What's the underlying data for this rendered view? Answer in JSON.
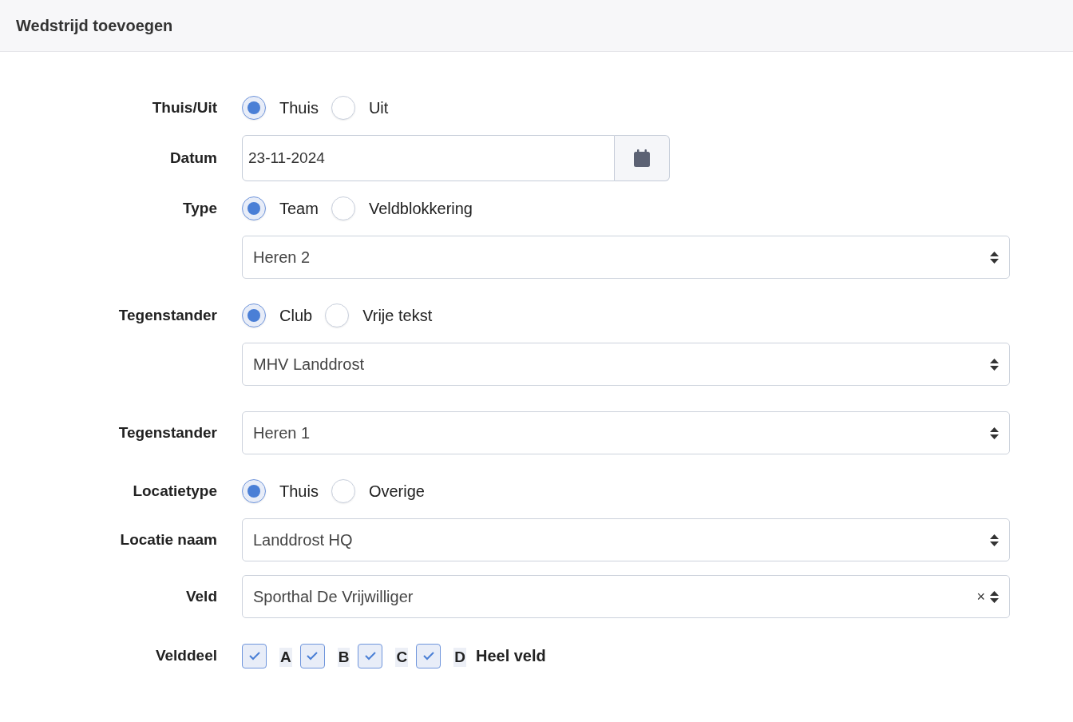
{
  "header": {
    "title": "Wedstrijd toevoegen"
  },
  "rows": [
    {
      "kind": "radio",
      "label": "Thuis/Uit",
      "options": [
        {
          "label": "Thuis",
          "selected": true
        },
        {
          "label": "Uit",
          "selected": false
        }
      ]
    },
    {
      "kind": "date",
      "label": "Datum",
      "value": "23-11-2024"
    },
    {
      "kind": "radio",
      "label": "Type",
      "options": [
        {
          "label": "Team",
          "selected": true
        },
        {
          "label": "Veldblokkering",
          "selected": false
        }
      ]
    },
    {
      "kind": "select",
      "value": "Heren 2"
    },
    {
      "kind": "radio",
      "label": "Tegenstander",
      "options": [
        {
          "label": "Club",
          "selected": true
        },
        {
          "label": "Vrije tekst",
          "selected": false
        }
      ]
    },
    {
      "kind": "select",
      "value": "MHV Landdrost"
    },
    {
      "kind": "select",
      "label": "Tegenstander",
      "value": "Heren 1"
    },
    {
      "kind": "radio",
      "label": "Locatietype",
      "options": [
        {
          "label": "Thuis",
          "selected": true
        },
        {
          "label": "Overige",
          "selected": false
        }
      ]
    },
    {
      "kind": "select",
      "label": "Locatie naam",
      "value": "Landdrost HQ"
    },
    {
      "kind": "select",
      "label": "Veld",
      "value": "Sporthal De Vrijwilliger",
      "clear": "×"
    },
    {
      "kind": "checkboxes",
      "label": "Velddeel",
      "options": [
        {
          "label": "A",
          "checked": true
        },
        {
          "label": "B",
          "checked": true
        },
        {
          "label": "C",
          "checked": true
        },
        {
          "label": "D",
          "checked": true
        }
      ],
      "note": "Heel veld"
    }
  ]
}
